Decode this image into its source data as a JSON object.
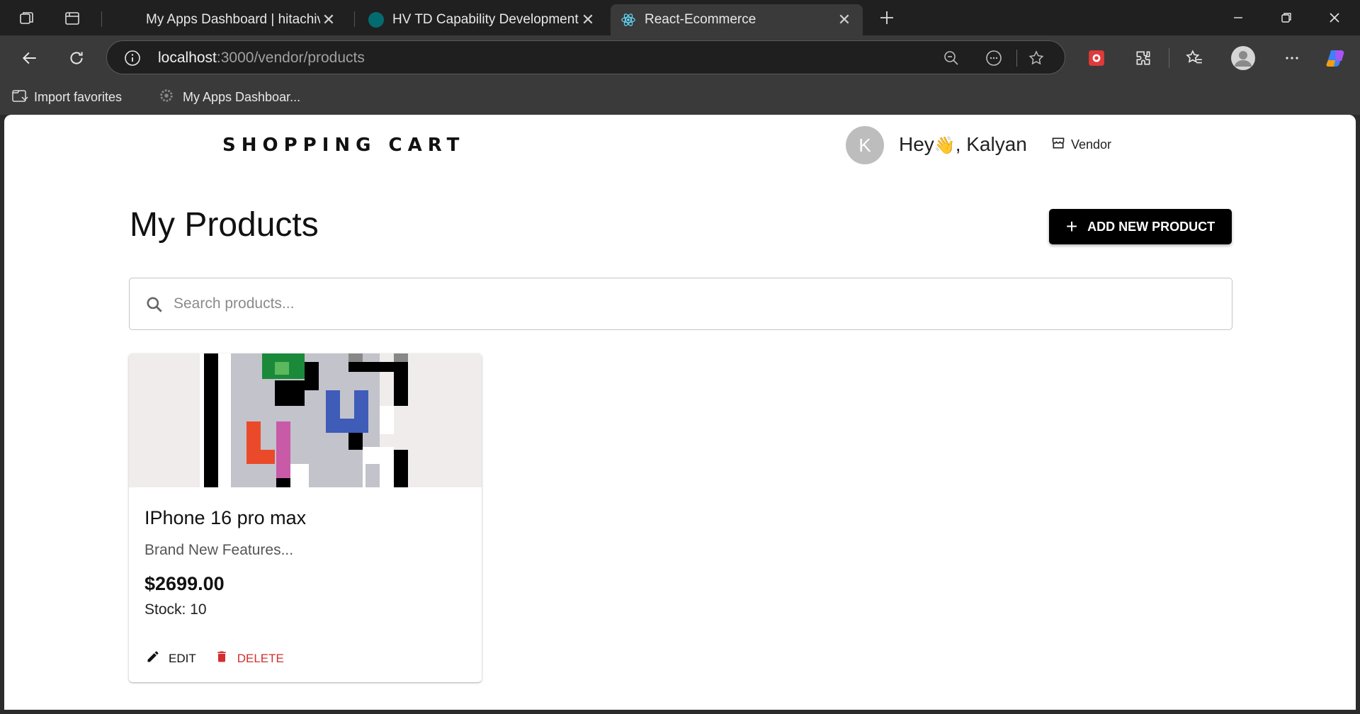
{
  "browser": {
    "tabs": [
      {
        "title": "My Apps Dashboard | hitachivanta",
        "active": false
      },
      {
        "title": "HV TD Capability Development (L",
        "active": false
      },
      {
        "title": "React-Ecommerce",
        "active": true
      }
    ],
    "url_host": "localhost",
    "url_path": ":3000/vendor/products",
    "favorites": [
      {
        "label": "Import favorites"
      },
      {
        "label": "My Apps Dashboar..."
      }
    ]
  },
  "header": {
    "brand": "SHOPPING CART",
    "avatar_initial": "K",
    "greeting_prefix": "Hey",
    "wave_emoji": "👋",
    "greeting_name": ", Kalyan",
    "vendor_label": "Vendor"
  },
  "main": {
    "title": "My Products",
    "add_button_label": "ADD NEW PRODUCT",
    "search_placeholder": "Search products...",
    "products": [
      {
        "name": "IPhone 16 pro max",
        "description": "Brand New Features...",
        "price": "$2699.00",
        "stock": "Stock: 10",
        "edit_label": "EDIT",
        "delete_label": "DELETE"
      }
    ]
  },
  "colors": {
    "accent": "#000000",
    "danger": "#d32f2f",
    "chrome_dark": "#202020",
    "chrome_toolbar": "#3a3a3a"
  }
}
